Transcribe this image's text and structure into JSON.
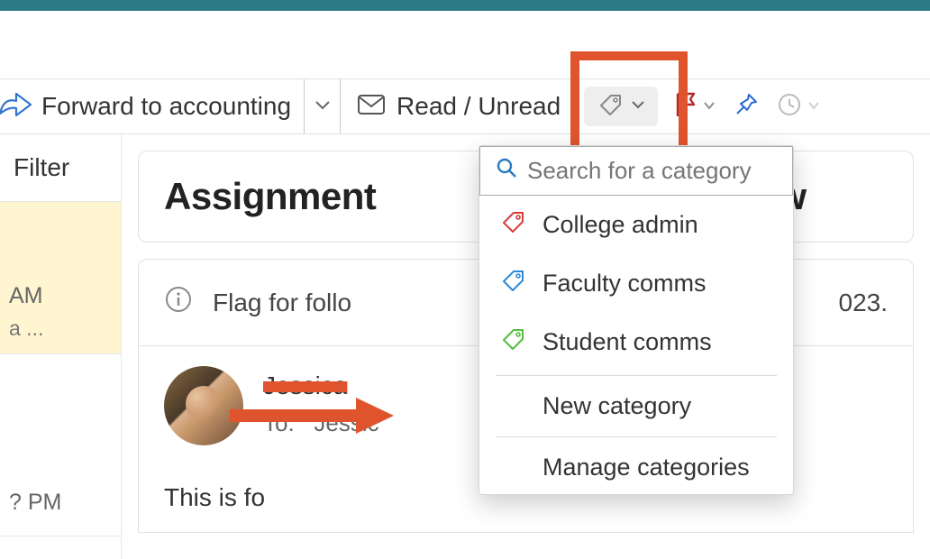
{
  "toolbar": {
    "quickstep_label": "Forward to accounting",
    "read_unread_label": "Read / Unread"
  },
  "list": {
    "filter_label": "Filter",
    "items": [
      {
        "time_suffix": " AM",
        "preview_suffix": "a ..."
      },
      {
        "time_suffix": "? PM",
        "preview_suffix": ""
      }
    ]
  },
  "message": {
    "subject_left": "Assignment",
    "subject_right": "iew",
    "flag_text_left": "Flag for follo",
    "flag_text_right": "023.",
    "sender_name": "Jessica",
    "recipients_label": "To:",
    "recipients_value": "Jessic",
    "body_text": "This is fo"
  },
  "dropdown": {
    "search_placeholder": "Search for a category",
    "categories": [
      {
        "label": "College admin",
        "color": "#d83b3b"
      },
      {
        "label": "Faculty comms",
        "color": "#2d8ad8"
      },
      {
        "label": "Student comms",
        "color": "#4fbf3a"
      }
    ],
    "new_category_label": "New category",
    "manage_label": "Manage categories"
  }
}
